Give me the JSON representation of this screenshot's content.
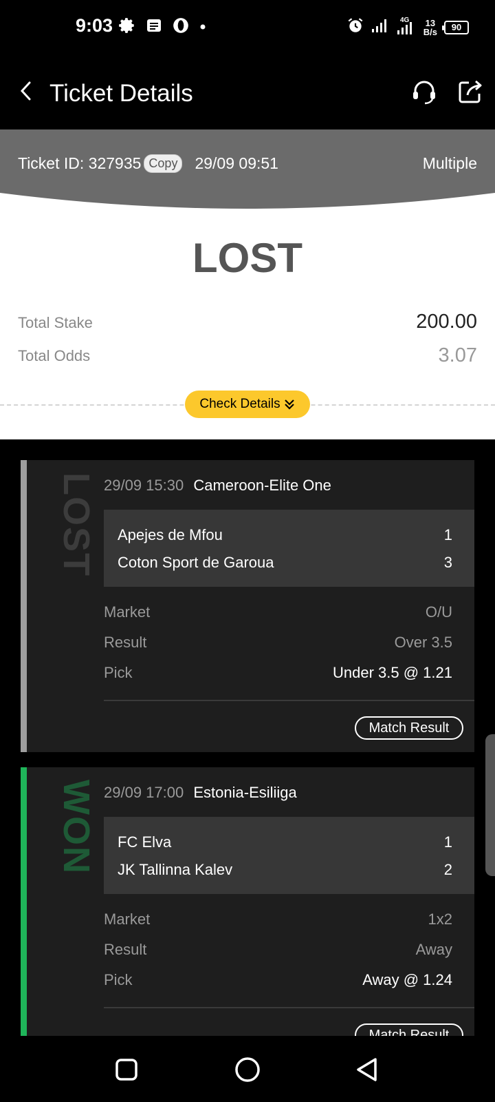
{
  "status_bar": {
    "time": "9:03",
    "net_speed_value": "13",
    "net_speed_unit": "B/s",
    "battery": "90",
    "network": "4G"
  },
  "header": {
    "title": "Ticket Details"
  },
  "ticket": {
    "id_label": "Ticket ID: 327935",
    "copy_label": "Copy",
    "datetime": "29/09 09:51",
    "type": "Multiple",
    "status": "LOST",
    "total_stake_label": "Total Stake",
    "total_stake_value": "200.00",
    "total_odds_label": "Total Odds",
    "total_odds_value": "3.07",
    "check_details_label": "Check Details"
  },
  "bets": [
    {
      "stamp": "LOST",
      "time": "29/09 15:30",
      "league": "Cameroon-Elite One",
      "home_team": "Apejes de Mfou",
      "home_score": "1",
      "away_team": "Coton Sport de Garoua",
      "away_score": "3",
      "market_label": "Market",
      "market_value": "O/U",
      "result_label": "Result",
      "result_value": "Over 3.5",
      "pick_label": "Pick",
      "pick_value": "Under 3.5 @ 1.21",
      "match_result_label": "Match Result"
    },
    {
      "stamp": "WON",
      "time": "29/09 17:00",
      "league": "Estonia-Esiliiga",
      "home_team": "FC Elva",
      "home_score": "1",
      "away_team": "JK Tallinna Kalev",
      "away_score": "2",
      "market_label": "Market",
      "market_value": "1x2",
      "result_label": "Result",
      "result_value": "Away",
      "pick_label": "Pick",
      "pick_value": "Away @ 1.24",
      "match_result_label": "Match Result"
    }
  ],
  "colors": {
    "accent_yellow": "#fcc82c",
    "lost_bar": "#9e9e9e",
    "won_bar": "#1fb55a",
    "won_stamp": "#1e5a36",
    "lost_stamp": "#3c3c3c",
    "card_bg": "#1e1e1e",
    "band_gray": "#6b6b6b"
  }
}
